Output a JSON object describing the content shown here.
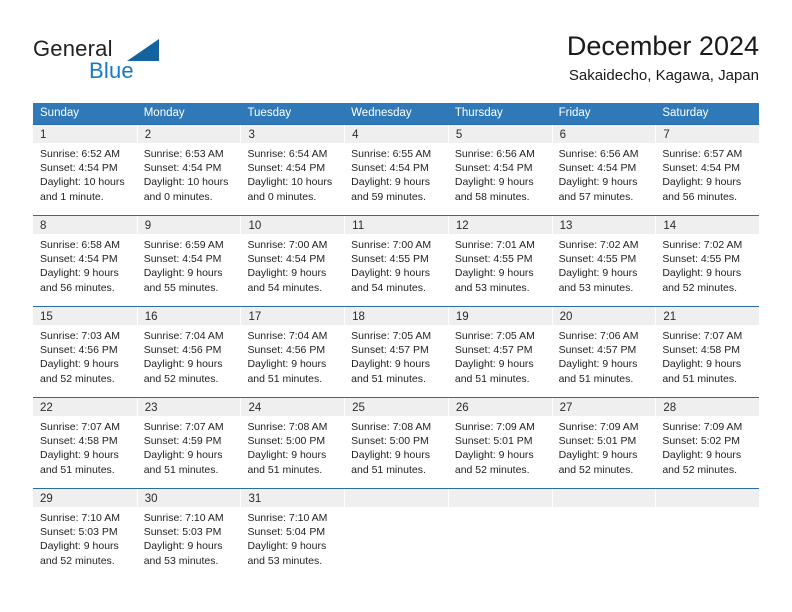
{
  "brand": {
    "name_part1": "General",
    "name_part2": "Blue",
    "accent_color": "#1879c6",
    "triangle_color": "#14639e",
    "triangle_icon": "triangle-icon"
  },
  "header": {
    "title": "December 2024",
    "subtitle": "Sakaidecho, Kagawa, Japan"
  },
  "calendar": {
    "header_bg": "#3079b8",
    "header_text_color": "#ffffff",
    "row_divider_color": "#2a6ca8",
    "day_band_bg": "#efefef",
    "weekdays": [
      "Sunday",
      "Monday",
      "Tuesday",
      "Wednesday",
      "Thursday",
      "Friday",
      "Saturday"
    ],
    "weeks": [
      [
        {
          "day": "1",
          "sunrise": "Sunrise: 6:52 AM",
          "sunset": "Sunset: 4:54 PM",
          "daylight1": "Daylight: 10 hours",
          "daylight2": "and 1 minute."
        },
        {
          "day": "2",
          "sunrise": "Sunrise: 6:53 AM",
          "sunset": "Sunset: 4:54 PM",
          "daylight1": "Daylight: 10 hours",
          "daylight2": "and 0 minutes."
        },
        {
          "day": "3",
          "sunrise": "Sunrise: 6:54 AM",
          "sunset": "Sunset: 4:54 PM",
          "daylight1": "Daylight: 10 hours",
          "daylight2": "and 0 minutes."
        },
        {
          "day": "4",
          "sunrise": "Sunrise: 6:55 AM",
          "sunset": "Sunset: 4:54 PM",
          "daylight1": "Daylight: 9 hours",
          "daylight2": "and 59 minutes."
        },
        {
          "day": "5",
          "sunrise": "Sunrise: 6:56 AM",
          "sunset": "Sunset: 4:54 PM",
          "daylight1": "Daylight: 9 hours",
          "daylight2": "and 58 minutes."
        },
        {
          "day": "6",
          "sunrise": "Sunrise: 6:56 AM",
          "sunset": "Sunset: 4:54 PM",
          "daylight1": "Daylight: 9 hours",
          "daylight2": "and 57 minutes."
        },
        {
          "day": "7",
          "sunrise": "Sunrise: 6:57 AM",
          "sunset": "Sunset: 4:54 PM",
          "daylight1": "Daylight: 9 hours",
          "daylight2": "and 56 minutes."
        }
      ],
      [
        {
          "day": "8",
          "sunrise": "Sunrise: 6:58 AM",
          "sunset": "Sunset: 4:54 PM",
          "daylight1": "Daylight: 9 hours",
          "daylight2": "and 56 minutes."
        },
        {
          "day": "9",
          "sunrise": "Sunrise: 6:59 AM",
          "sunset": "Sunset: 4:54 PM",
          "daylight1": "Daylight: 9 hours",
          "daylight2": "and 55 minutes."
        },
        {
          "day": "10",
          "sunrise": "Sunrise: 7:00 AM",
          "sunset": "Sunset: 4:54 PM",
          "daylight1": "Daylight: 9 hours",
          "daylight2": "and 54 minutes."
        },
        {
          "day": "11",
          "sunrise": "Sunrise: 7:00 AM",
          "sunset": "Sunset: 4:55 PM",
          "daylight1": "Daylight: 9 hours",
          "daylight2": "and 54 minutes."
        },
        {
          "day": "12",
          "sunrise": "Sunrise: 7:01 AM",
          "sunset": "Sunset: 4:55 PM",
          "daylight1": "Daylight: 9 hours",
          "daylight2": "and 53 minutes."
        },
        {
          "day": "13",
          "sunrise": "Sunrise: 7:02 AM",
          "sunset": "Sunset: 4:55 PM",
          "daylight1": "Daylight: 9 hours",
          "daylight2": "and 53 minutes."
        },
        {
          "day": "14",
          "sunrise": "Sunrise: 7:02 AM",
          "sunset": "Sunset: 4:55 PM",
          "daylight1": "Daylight: 9 hours",
          "daylight2": "and 52 minutes."
        }
      ],
      [
        {
          "day": "15",
          "sunrise": "Sunrise: 7:03 AM",
          "sunset": "Sunset: 4:56 PM",
          "daylight1": "Daylight: 9 hours",
          "daylight2": "and 52 minutes."
        },
        {
          "day": "16",
          "sunrise": "Sunrise: 7:04 AM",
          "sunset": "Sunset: 4:56 PM",
          "daylight1": "Daylight: 9 hours",
          "daylight2": "and 52 minutes."
        },
        {
          "day": "17",
          "sunrise": "Sunrise: 7:04 AM",
          "sunset": "Sunset: 4:56 PM",
          "daylight1": "Daylight: 9 hours",
          "daylight2": "and 51 minutes."
        },
        {
          "day": "18",
          "sunrise": "Sunrise: 7:05 AM",
          "sunset": "Sunset: 4:57 PM",
          "daylight1": "Daylight: 9 hours",
          "daylight2": "and 51 minutes."
        },
        {
          "day": "19",
          "sunrise": "Sunrise: 7:05 AM",
          "sunset": "Sunset: 4:57 PM",
          "daylight1": "Daylight: 9 hours",
          "daylight2": "and 51 minutes."
        },
        {
          "day": "20",
          "sunrise": "Sunrise: 7:06 AM",
          "sunset": "Sunset: 4:57 PM",
          "daylight1": "Daylight: 9 hours",
          "daylight2": "and 51 minutes."
        },
        {
          "day": "21",
          "sunrise": "Sunrise: 7:07 AM",
          "sunset": "Sunset: 4:58 PM",
          "daylight1": "Daylight: 9 hours",
          "daylight2": "and 51 minutes."
        }
      ],
      [
        {
          "day": "22",
          "sunrise": "Sunrise: 7:07 AM",
          "sunset": "Sunset: 4:58 PM",
          "daylight1": "Daylight: 9 hours",
          "daylight2": "and 51 minutes."
        },
        {
          "day": "23",
          "sunrise": "Sunrise: 7:07 AM",
          "sunset": "Sunset: 4:59 PM",
          "daylight1": "Daylight: 9 hours",
          "daylight2": "and 51 minutes."
        },
        {
          "day": "24",
          "sunrise": "Sunrise: 7:08 AM",
          "sunset": "Sunset: 5:00 PM",
          "daylight1": "Daylight: 9 hours",
          "daylight2": "and 51 minutes."
        },
        {
          "day": "25",
          "sunrise": "Sunrise: 7:08 AM",
          "sunset": "Sunset: 5:00 PM",
          "daylight1": "Daylight: 9 hours",
          "daylight2": "and 51 minutes."
        },
        {
          "day": "26",
          "sunrise": "Sunrise: 7:09 AM",
          "sunset": "Sunset: 5:01 PM",
          "daylight1": "Daylight: 9 hours",
          "daylight2": "and 52 minutes."
        },
        {
          "day": "27",
          "sunrise": "Sunrise: 7:09 AM",
          "sunset": "Sunset: 5:01 PM",
          "daylight1": "Daylight: 9 hours",
          "daylight2": "and 52 minutes."
        },
        {
          "day": "28",
          "sunrise": "Sunrise: 7:09 AM",
          "sunset": "Sunset: 5:02 PM",
          "daylight1": "Daylight: 9 hours",
          "daylight2": "and 52 minutes."
        }
      ],
      [
        {
          "day": "29",
          "sunrise": "Sunrise: 7:10 AM",
          "sunset": "Sunset: 5:03 PM",
          "daylight1": "Daylight: 9 hours",
          "daylight2": "and 52 minutes."
        },
        {
          "day": "30",
          "sunrise": "Sunrise: 7:10 AM",
          "sunset": "Sunset: 5:03 PM",
          "daylight1": "Daylight: 9 hours",
          "daylight2": "and 53 minutes."
        },
        {
          "day": "31",
          "sunrise": "Sunrise: 7:10 AM",
          "sunset": "Sunset: 5:04 PM",
          "daylight1": "Daylight: 9 hours",
          "daylight2": "and 53 minutes."
        },
        {
          "day": "",
          "sunrise": "",
          "sunset": "",
          "daylight1": "",
          "daylight2": ""
        },
        {
          "day": "",
          "sunrise": "",
          "sunset": "",
          "daylight1": "",
          "daylight2": ""
        },
        {
          "day": "",
          "sunrise": "",
          "sunset": "",
          "daylight1": "",
          "daylight2": ""
        },
        {
          "day": "",
          "sunrise": "",
          "sunset": "",
          "daylight1": "",
          "daylight2": ""
        }
      ]
    ]
  }
}
